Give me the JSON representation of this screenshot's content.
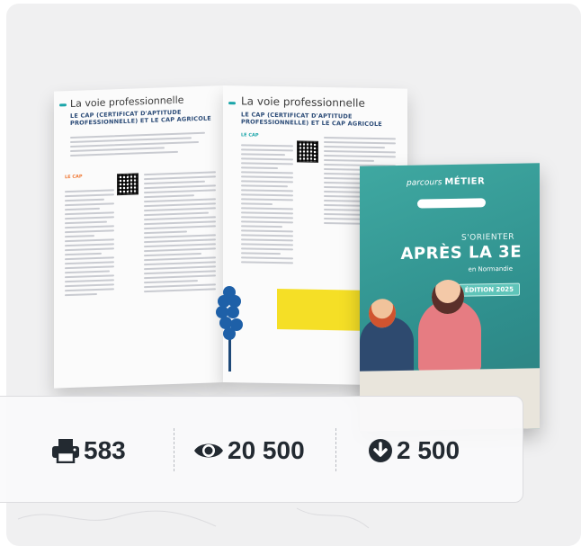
{
  "brochure": {
    "left_page_title": "La voie professionnelle",
    "left_page_subtitle": "LE CAP (CERTIFICAT D'APTITUDE PROFESSIONNELLE) ET LE CAP AGRICOLE",
    "right_page_title": "La voie professionnelle",
    "right_page_subtitle": "LE CAP (CERTIFICAT D'APTITUDE PROFESSIONNELLE) ET LE CAP AGRICOLE",
    "cover": {
      "brand": "parcours",
      "brand_bold": "MÉTIER",
      "line1": "S'ORIENTER",
      "line2": "APRÈS LA 3E",
      "line3": "en Normandie",
      "edition": "ÉDITION 2025"
    }
  },
  "stats": {
    "prints": "583",
    "views": "20 500",
    "downloads": "2 500"
  },
  "icons": {
    "prints": "printer-icon",
    "views": "eye-icon",
    "downloads": "download-icon"
  }
}
